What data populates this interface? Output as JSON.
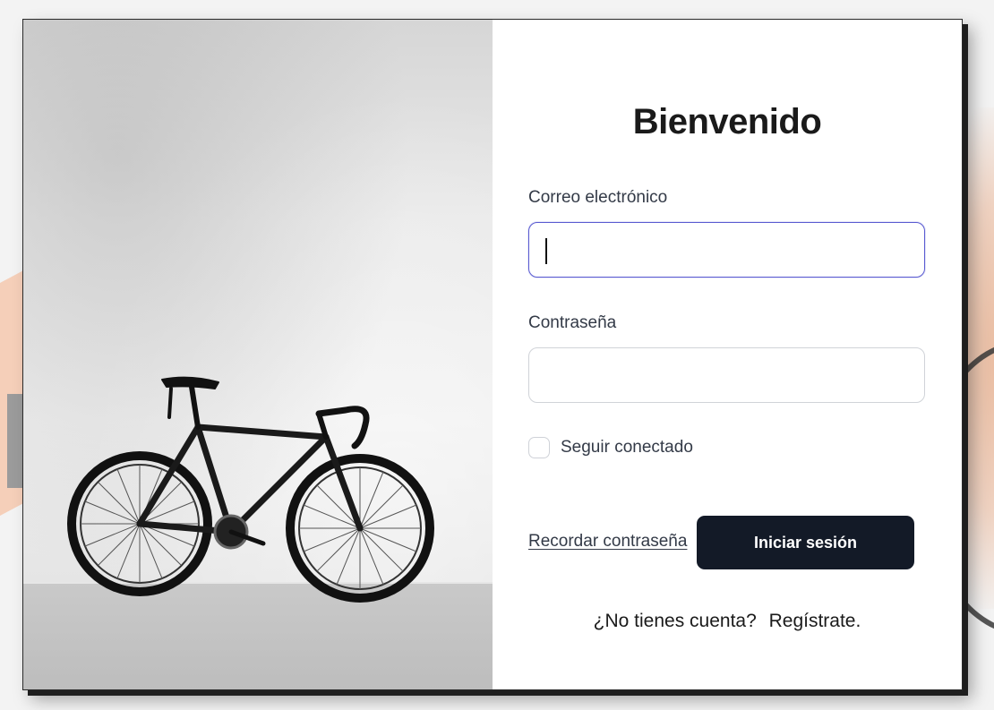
{
  "login": {
    "title": "Bienvenido",
    "email_label": "Correo electrónico",
    "email_value": "",
    "password_label": "Contraseña",
    "password_value": "",
    "remember_label": "Seguir conectado",
    "remember_checked": false,
    "forgot_link": "Recordar contraseña",
    "submit_button": "Iniciar sesión",
    "no_account_text": "¿No tienes cuenta?",
    "register_link": "Regístrate."
  },
  "colors": {
    "button_bg": "#131a27",
    "focus_border": "#5a5bd1",
    "text": "#333a47"
  },
  "icons": {
    "hero_image": "bicycle-photo"
  }
}
